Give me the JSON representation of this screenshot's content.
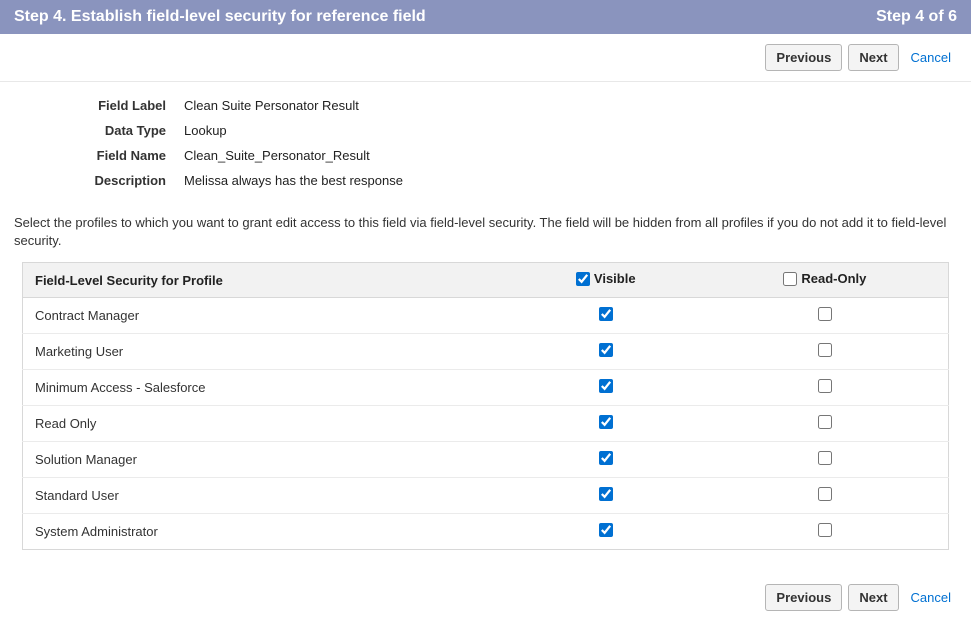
{
  "header": {
    "title": "Step 4. Establish field-level security for reference field",
    "step_indicator": "Step 4 of 6"
  },
  "actions": {
    "previous": "Previous",
    "next": "Next",
    "cancel": "Cancel"
  },
  "details": {
    "field_label_label": "Field Label",
    "field_label_value": "Clean Suite Personator Result",
    "data_type_label": "Data Type",
    "data_type_value": "Lookup",
    "field_name_label": "Field Name",
    "field_name_value": "Clean_Suite_Personator_Result",
    "description_label": "Description",
    "description_value": "Melissa always has the best response"
  },
  "instruction": "Select the profiles to which you want to grant edit access to this field via field-level security. The field will be hidden from all profiles if you do not add it to field-level security.",
  "table": {
    "col_profile": "Field-Level Security for Profile",
    "col_visible": "Visible",
    "col_readonly": "Read-Only",
    "header_visible_checked": true,
    "header_readonly_checked": false,
    "rows": [
      {
        "profile": "Contract Manager",
        "visible": true,
        "readonly": false
      },
      {
        "profile": "Marketing User",
        "visible": true,
        "readonly": false
      },
      {
        "profile": "Minimum Access - Salesforce",
        "visible": true,
        "readonly": false
      },
      {
        "profile": "Read Only",
        "visible": true,
        "readonly": false
      },
      {
        "profile": "Solution Manager",
        "visible": true,
        "readonly": false
      },
      {
        "profile": "Standard User",
        "visible": true,
        "readonly": false
      },
      {
        "profile": "System Administrator",
        "visible": true,
        "readonly": false
      }
    ]
  }
}
